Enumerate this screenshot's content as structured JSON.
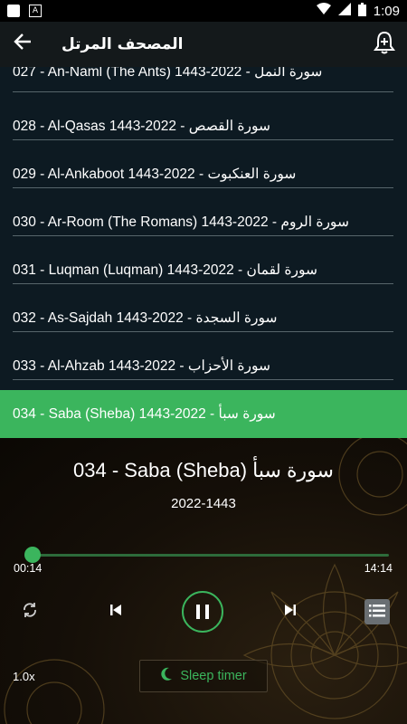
{
  "status_bar": {
    "time": "1:09"
  },
  "app_bar": {
    "title": "المصحف المرتل"
  },
  "list": {
    "items": [
      {
        "label": "027 - An-Naml (The Ants) 1443-2022 - سورة النمل"
      },
      {
        "label": "028 - Al-Qasas 1443-2022 - سورة القصص"
      },
      {
        "label": "029 - Al-Ankaboot  1443-2022 - سورة العنكبوت"
      },
      {
        "label": "030 - Ar-Room (The Romans) 1443-2022 - سورة الروم"
      },
      {
        "label": "031 - Luqman (Luqman) 1443-2022 - سورة لقمان"
      },
      {
        "label": "032 - As-Sajdah  1443-2022 - سورة السجدة"
      },
      {
        "label": "033 - Al-Ahzab  1443-2022 - سورة الأحزاب"
      },
      {
        "label": "034 - Saba (Sheba) 1443-2022 - سورة سبأ"
      }
    ]
  },
  "player": {
    "title": "034 - Saba (Sheba) سورة سبأ",
    "subtitle": "2022-1443",
    "elapsed": "00:14",
    "duration": "14:14",
    "progress": 0.017,
    "speed": "1.0x",
    "sleep_timer_label": "Sleep timer"
  },
  "colors": {
    "accent": "#3bb55d",
    "list_bg": "#0d1a22",
    "app_bar_bg": "#14191b"
  },
  "icons": [
    "back-arrow-icon",
    "add-alarm-icon",
    "repeat-icon",
    "skip-previous-icon",
    "pause-icon",
    "skip-next-icon",
    "playlist-icon",
    "moon-icon"
  ]
}
